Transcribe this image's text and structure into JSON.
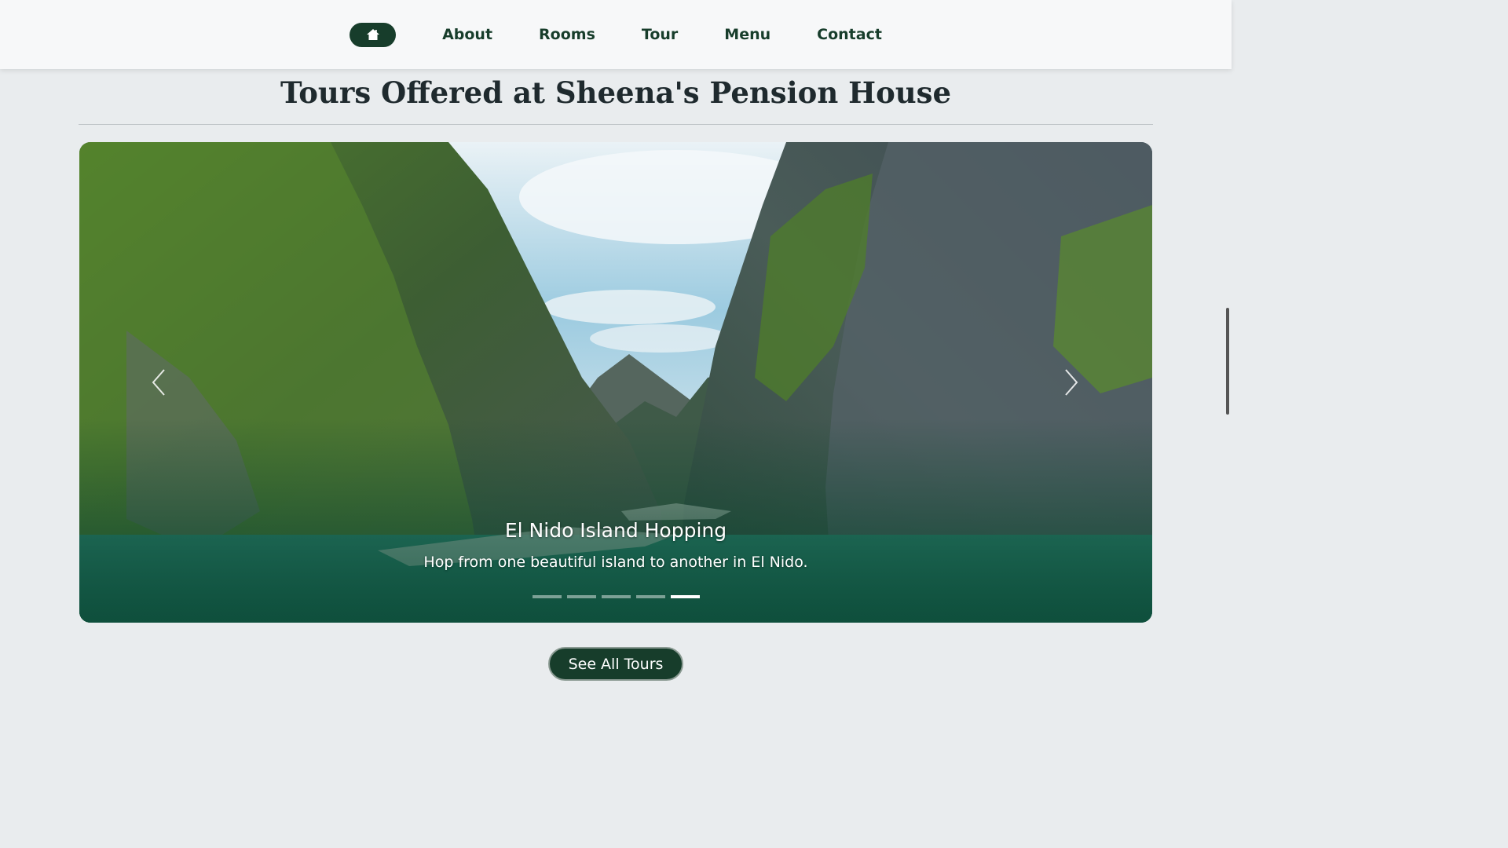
{
  "nav": {
    "home_icon": "home-icon",
    "links": [
      "About",
      "Rooms",
      "Tour",
      "Menu",
      "Contact"
    ]
  },
  "section": {
    "title": "Tours Offered at Sheena's Pension House"
  },
  "carousel": {
    "caption_title": "El Nido Island Hopping",
    "caption_text": "Hop from one beautiful island to another in El Nido.",
    "slide_count": 5,
    "active_slide": 5,
    "prev_icon": "chevron-left-icon",
    "next_icon": "chevron-right-icon"
  },
  "cta": {
    "see_all_label": "See All Tours"
  },
  "colors": {
    "brand_green": "#173d2b",
    "background": "#e9ecee"
  }
}
